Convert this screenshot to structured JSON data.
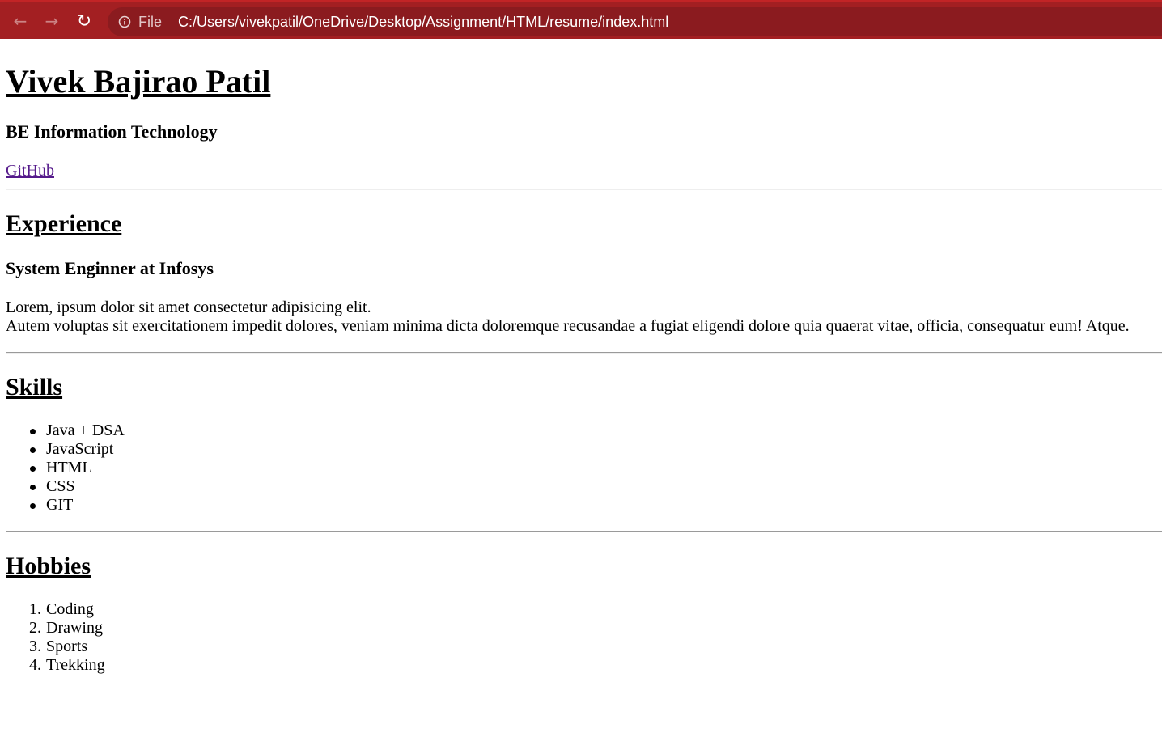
{
  "browser": {
    "back_icon": "arrow-left",
    "forward_icon": "arrow-right",
    "reload_icon": "reload",
    "scheme_label": "File",
    "url": "C:/Users/vivekpatil/OneDrive/Desktop/Assignment/HTML/resume/index.html",
    "theme_color": "#a31f22"
  },
  "resume": {
    "name": "Vivek Bajirao Patil",
    "degree": "BE Information Technology",
    "github_link": "GitHub",
    "experience": {
      "heading": "Experience",
      "job_title": "System Enginner at Infosys",
      "line1": "Lorem, ipsum dolor sit amet consectetur adipisicing elit.",
      "line2": "Autem voluptas sit exercitationem impedit dolores, veniam minima dicta doloremque recusandae a fugiat eligendi dolore quia quaerat vitae, officia, consequatur eum! Atque."
    },
    "skills": {
      "heading": "Skills",
      "items": [
        "Java + DSA",
        "JavaScript",
        "HTML",
        "CSS",
        "GIT"
      ]
    },
    "hobbies": {
      "heading": "Hobbies",
      "items": [
        {
          "num": "1.",
          "label": "Coding"
        },
        {
          "num": "2.",
          "label": "Drawing"
        },
        {
          "num": "3.",
          "label": "Sports"
        },
        {
          "num": "4.",
          "label": "Trekking"
        }
      ]
    }
  }
}
